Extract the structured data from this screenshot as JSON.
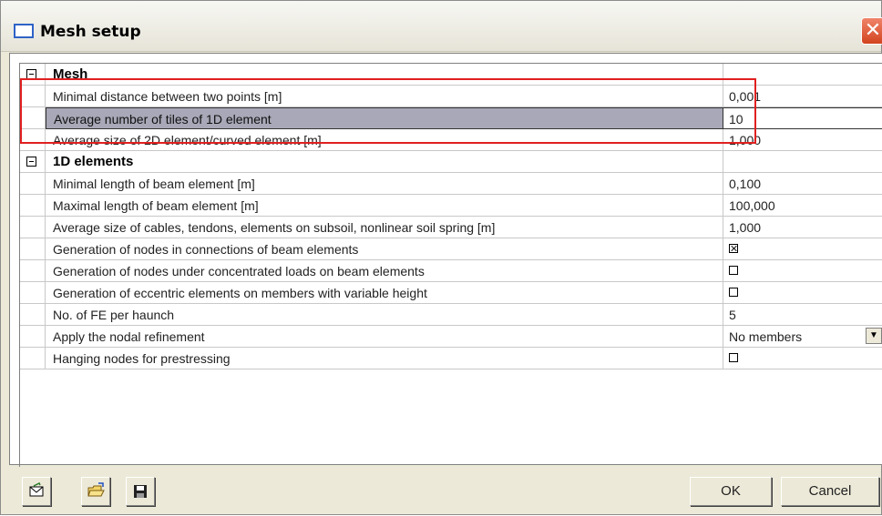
{
  "window": {
    "title": "Mesh setup"
  },
  "rows": [
    {
      "kind": "section",
      "label": "Mesh",
      "value": ""
    },
    {
      "kind": "item",
      "label": "Minimal distance between two points [m]",
      "value": "0,001"
    },
    {
      "kind": "item",
      "label": "Average number of tiles of 1D element",
      "value": "10",
      "selected": true
    },
    {
      "kind": "item",
      "label": "Average size of 2D element/curved element [m]",
      "value": "1,000"
    },
    {
      "kind": "section",
      "label": "1D elements",
      "value": ""
    },
    {
      "kind": "item",
      "label": "Minimal length of beam element [m]",
      "value": "0,100"
    },
    {
      "kind": "item",
      "label": "Maximal length of beam element [m]",
      "value": "100,000"
    },
    {
      "kind": "item",
      "label": "Average size of cables, tendons, elements on subsoil, nonlinear soil spring [m]",
      "value": "1,000"
    },
    {
      "kind": "checkbox",
      "label": "Generation of nodes in connections of beam elements",
      "checked": true
    },
    {
      "kind": "checkbox",
      "label": "Generation of nodes under concentrated loads on beam elements",
      "checked": false
    },
    {
      "kind": "checkbox",
      "label": "Generation of eccentric elements on members with variable height",
      "checked": false
    },
    {
      "kind": "item",
      "label": "No. of FE per haunch",
      "value": "5"
    },
    {
      "kind": "dropdown",
      "label": "Apply the nodal refinement",
      "value": "No members"
    },
    {
      "kind": "checkbox",
      "label": "Hanging nodes for prestressing",
      "checked": false
    }
  ],
  "buttons": {
    "ok": "OK",
    "cancel": "Cancel"
  },
  "icons": {
    "close": "close-icon",
    "default": "defaults-icon",
    "open": "open-folder-icon",
    "save": "save-icon"
  },
  "colors": {
    "highlight": "#e02020",
    "selected_row": "#a8a8b8"
  }
}
